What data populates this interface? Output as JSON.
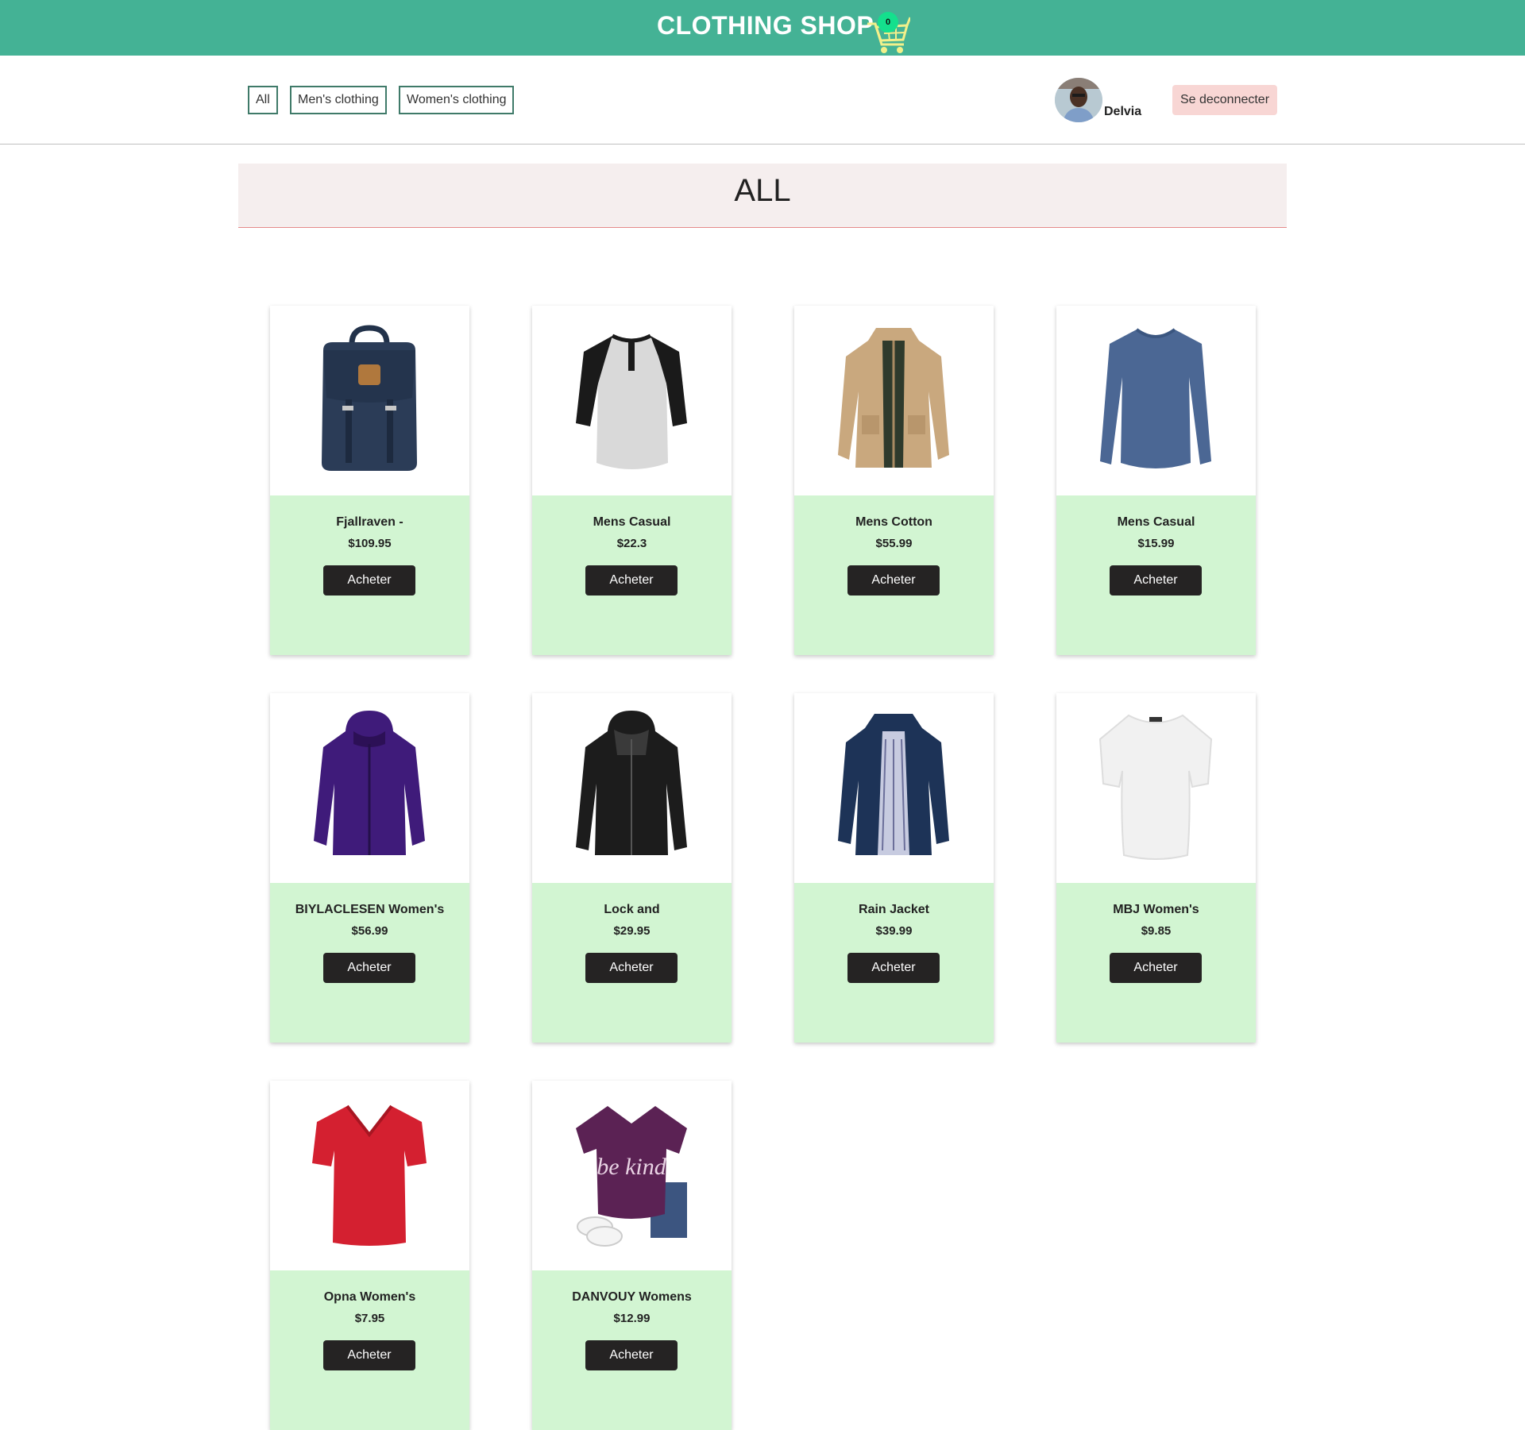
{
  "header": {
    "title": "CLOTHING SHOP",
    "cart_count": "0",
    "cart_icon": "shopping-cart-icon"
  },
  "filters": {
    "all": "All",
    "mens": "Men's clothing",
    "womens": "Women's clothing"
  },
  "user": {
    "name": "Delvia",
    "logout_label": "Se deconnecter"
  },
  "section": {
    "title": "ALL"
  },
  "products": [
    {
      "name": "Fjallraven -",
      "price": "$109.95",
      "buy_label": "Acheter",
      "image": "backpack"
    },
    {
      "name": "Mens Casual",
      "price": "$22.3",
      "buy_label": "Acheter",
      "image": "raglan-tshirt"
    },
    {
      "name": "Mens Cotton",
      "price": "$55.99",
      "buy_label": "Acheter",
      "image": "cotton-jacket"
    },
    {
      "name": "Mens Casual",
      "price": "$15.99",
      "buy_label": "Acheter",
      "image": "long-sleeve-shirt"
    },
    {
      "name": "BIYLACLESEN Women's",
      "price": "$56.99",
      "buy_label": "Acheter",
      "image": "purple-jacket"
    },
    {
      "name": "Lock and",
      "price": "$29.95",
      "buy_label": "Acheter",
      "image": "leather-jacket"
    },
    {
      "name": "Rain Jacket",
      "price": "$39.99",
      "buy_label": "Acheter",
      "image": "rain-jacket"
    },
    {
      "name": "MBJ Women's",
      "price": "$9.85",
      "buy_label": "Acheter",
      "image": "white-top"
    },
    {
      "name": "Opna Women's",
      "price": "$7.95",
      "buy_label": "Acheter",
      "image": "red-tshirt"
    },
    {
      "name": "DANVOUY Womens",
      "price": "$12.99",
      "buy_label": "Acheter",
      "image": "be-kind-tshirt",
      "image_text": "be kind"
    }
  ],
  "colors": {
    "header_bg": "#44b295",
    "card_bg": "#d2f5d2",
    "buy_button": "#252323",
    "logout_button": "#f8d6d4",
    "banner_bg": "#f5eeee"
  }
}
